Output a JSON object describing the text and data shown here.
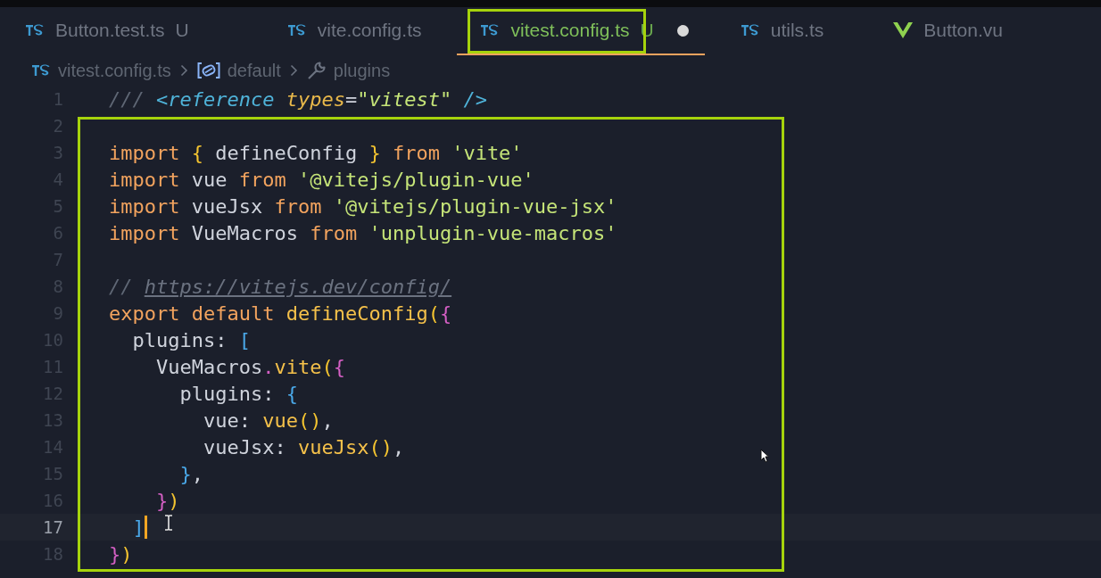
{
  "tabs": [
    {
      "kind": "ts",
      "label": "Button.test.ts",
      "status": "U",
      "selected": false,
      "dirty": false,
      "framed": false
    },
    {
      "kind": "ts",
      "label": "vite.config.ts",
      "selected": false,
      "dirty": false,
      "framed": false
    },
    {
      "kind": "ts",
      "label": "vitest.config.ts",
      "status": "U",
      "selected": true,
      "dirty": true,
      "framed": true
    },
    {
      "kind": "ts",
      "label": "utils.ts",
      "selected": false,
      "dirty": false,
      "framed": false
    },
    {
      "kind": "vue",
      "label": "Button.vu",
      "selected": false,
      "dirty": false,
      "framed": false
    }
  ],
  "breadcrumb": [
    {
      "kind": "ts",
      "label": "vitest.config.ts"
    },
    {
      "kind": "variable",
      "label": "default"
    },
    {
      "kind": "property",
      "label": "plugins"
    }
  ],
  "editor": {
    "framed": true,
    "lines": [
      {
        "number": "1",
        "current": false,
        "tokens": [
          {
            "t": "/// ",
            "kind": "comment"
          },
          {
            "t": "<reference",
            "kind": "tag"
          },
          {
            "t": " types",
            "kind": "attr"
          },
          {
            "t": "=",
            "kind": "plain"
          },
          {
            "t": "\"vitest\"",
            "kind": "istr"
          },
          {
            "t": " />",
            "kind": "tag"
          }
        ]
      },
      {
        "number": "2",
        "current": false
      },
      {
        "number": "3",
        "current": false,
        "tokens": [
          {
            "t": "import ",
            "kind": "keyword"
          },
          {
            "t": "{",
            "kind": "brace"
          },
          {
            "t": " defineConfig ",
            "kind": "plain"
          },
          {
            "t": "}",
            "kind": "brace"
          },
          {
            "t": " from ",
            "kind": "keyword"
          },
          {
            "t": "'vite'",
            "kind": "string"
          }
        ]
      },
      {
        "number": "4",
        "current": false,
        "tokens": [
          {
            "t": "import ",
            "kind": "keyword"
          },
          {
            "t": "vue ",
            "kind": "plain"
          },
          {
            "t": "from ",
            "kind": "keyword"
          },
          {
            "t": "'@vitejs/plugin-vue'",
            "kind": "string"
          }
        ]
      },
      {
        "number": "5",
        "current": false,
        "tokens": [
          {
            "t": "import ",
            "kind": "keyword"
          },
          {
            "t": "vueJsx ",
            "kind": "plain"
          },
          {
            "t": "from ",
            "kind": "keyword"
          },
          {
            "t": "'@vitejs/plugin-vue-jsx'",
            "kind": "string"
          }
        ]
      },
      {
        "number": "6",
        "current": false,
        "tokens": [
          {
            "t": "import ",
            "kind": "keyword"
          },
          {
            "t": "VueMacros ",
            "kind": "plain"
          },
          {
            "t": "from ",
            "kind": "keyword"
          },
          {
            "t": "'unplugin-vue-macros'",
            "kind": "string"
          }
        ]
      },
      {
        "number": "7",
        "current": false
      },
      {
        "number": "8",
        "current": false,
        "tokens": [
          {
            "t": "// ",
            "kind": "comment"
          },
          {
            "t": "https://vitejs.dev/config/",
            "kind": "link"
          }
        ]
      },
      {
        "number": "9",
        "current": false,
        "tokens": [
          {
            "t": "export default ",
            "kind": "keyword"
          },
          {
            "t": "defineConfig",
            "kind": "func"
          },
          {
            "t": "(",
            "kind": "brace"
          },
          {
            "t": "{",
            "kind": "pink"
          }
        ]
      },
      {
        "number": "10",
        "current": false,
        "tokens": [
          {
            "t": "  plugins: ",
            "kind": "plain"
          },
          {
            "t": "[",
            "kind": "blue"
          }
        ]
      },
      {
        "number": "11",
        "current": false,
        "tokens": [
          {
            "t": "    VueMacros",
            "kind": "plain"
          },
          {
            "t": ".",
            "kind": "pink"
          },
          {
            "t": "vite",
            "kind": "func"
          },
          {
            "t": "(",
            "kind": "brace"
          },
          {
            "t": "{",
            "kind": "pink"
          }
        ]
      },
      {
        "number": "12",
        "current": false,
        "tokens": [
          {
            "t": "      plugins: ",
            "kind": "plain"
          },
          {
            "t": "{",
            "kind": "blue"
          }
        ]
      },
      {
        "number": "13",
        "current": false,
        "tokens": [
          {
            "t": "        vue: ",
            "kind": "plain"
          },
          {
            "t": "vue",
            "kind": "func"
          },
          {
            "t": "()",
            "kind": "brace"
          },
          {
            "t": ",",
            "kind": "plain"
          }
        ]
      },
      {
        "number": "14",
        "current": false,
        "tokens": [
          {
            "t": "        vueJsx: ",
            "kind": "plain"
          },
          {
            "t": "vueJsx",
            "kind": "func"
          },
          {
            "t": "()",
            "kind": "brace"
          },
          {
            "t": ",",
            "kind": "plain"
          }
        ]
      },
      {
        "number": "15",
        "current": false,
        "tokens": [
          {
            "t": "      }",
            "kind": "blue"
          },
          {
            "t": ",",
            "kind": "plain"
          }
        ]
      },
      {
        "number": "16",
        "current": false,
        "tokens": [
          {
            "t": "    }",
            "kind": "pink"
          },
          {
            "t": ")",
            "kind": "brace"
          }
        ]
      },
      {
        "number": "17",
        "current": true,
        "tokens": [
          {
            "t": "  ]",
            "kind": "blue"
          }
        ]
      },
      {
        "number": "18",
        "current": false,
        "tokens": [
          {
            "t": "}",
            "kind": "pink"
          },
          {
            "t": ")",
            "kind": "brace"
          }
        ]
      }
    ]
  }
}
